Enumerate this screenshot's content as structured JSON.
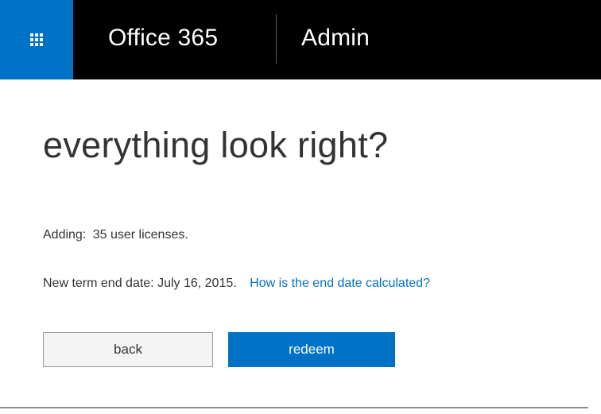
{
  "header": {
    "brand": "Office 365",
    "app_name": "Admin",
    "app_launcher_icon": "waffle-grid-icon",
    "brand_color": "#0072c6",
    "bar_color": "#000000"
  },
  "main": {
    "title": "everything look right?",
    "adding_label": "Adding:",
    "adding_value": "35 user licenses.",
    "term_end_text": "New term end date: July 16, 2015.",
    "help_link": "How is the end date calculated?",
    "link_color": "#0072c6"
  },
  "actions": {
    "back_label": "back",
    "redeem_label": "redeem",
    "primary_color": "#0072c6"
  }
}
